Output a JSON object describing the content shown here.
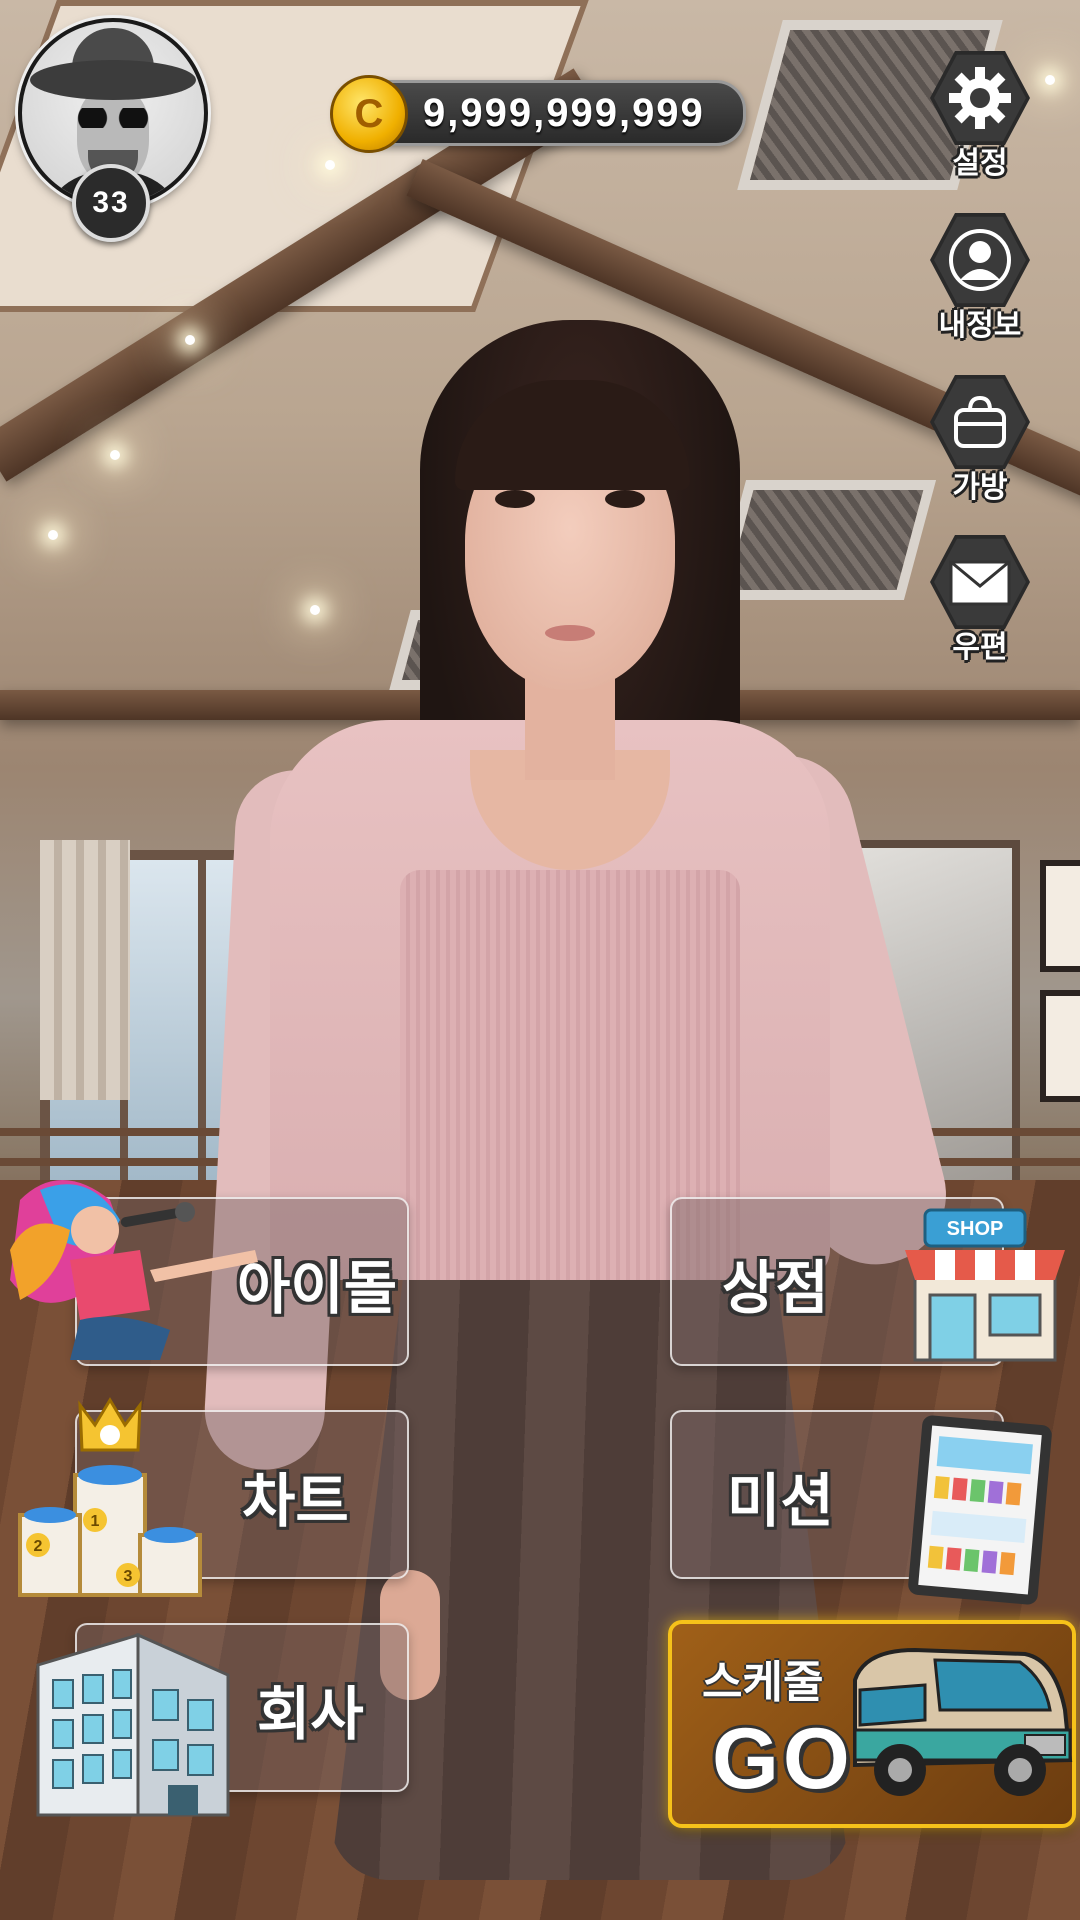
{
  "player": {
    "level": "33"
  },
  "currency": {
    "coin_symbol": "C",
    "amount": "9,999,999,999"
  },
  "side_menu": [
    {
      "label": "설정",
      "icon": "gear-icon"
    },
    {
      "label": "내정보",
      "icon": "profile-icon"
    },
    {
      "label": "가방",
      "icon": "bag-icon"
    },
    {
      "label": "우편",
      "icon": "mail-icon"
    }
  ],
  "main_menu": {
    "idol": "아이돌",
    "shop": "상점",
    "chart": "차트",
    "mission": "미션",
    "company": "회사"
  },
  "shop_sign": "SHOP",
  "podium_places": [
    "1",
    "2",
    "3"
  ],
  "schedule": {
    "title": "스케줄",
    "go": "GO"
  }
}
